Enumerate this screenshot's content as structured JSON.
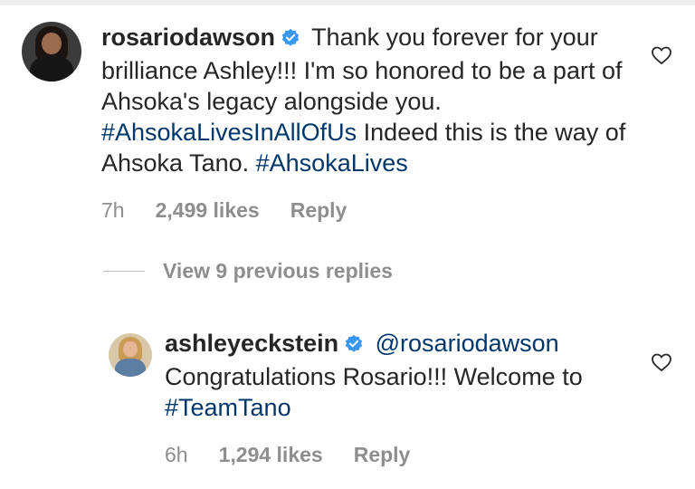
{
  "comment": {
    "username": "rosariodawson",
    "text_1": "Thank you forever for your brilliance Ashley!!! I'm so honored to be a part of Ahsoka's legacy alongside you.",
    "tag_1": "#AhsokaLivesInAllOfUs",
    "text_2": "Indeed this is the way of Ahsoka Tano.",
    "tag_2": "#AhsokaLives",
    "time": "7h",
    "likes": "2,499 likes",
    "reply_label": "Reply",
    "avatar_icon": "profile-photo",
    "like_icon": "heart-outline-icon"
  },
  "view_replies": {
    "label": "View 9 previous replies"
  },
  "reply": {
    "username": "ashleyeckstein",
    "mention": "@rosariodawson",
    "text": "Congratulations Rosario!!! Welcome to",
    "tag": "#TeamTano",
    "time": "6h",
    "likes": "1,294 likes",
    "reply_label": "Reply",
    "avatar_icon": "profile-photo",
    "like_icon": "heart-outline-icon"
  },
  "colors": {
    "verified_badge": "#3897f0",
    "hashtag": "#00376b",
    "meta_text": "#8e8e8e",
    "body_text": "#262626"
  }
}
